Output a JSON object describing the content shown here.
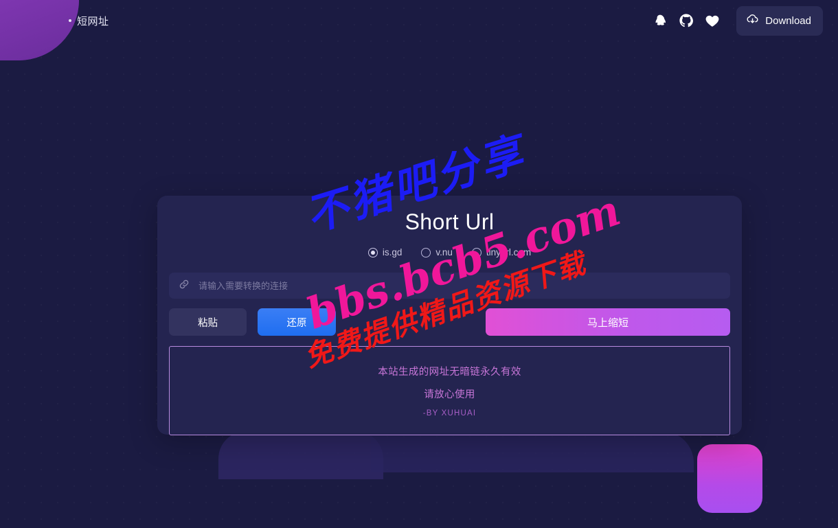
{
  "header": {
    "brand_label": "短网址",
    "icons": [
      {
        "name": "qq-icon",
        "label": "QQ"
      },
      {
        "name": "github-icon",
        "label": "GitHub"
      },
      {
        "name": "heart-icon",
        "label": "Favorite"
      }
    ],
    "download_label": "Download"
  },
  "card": {
    "title": "Short Url",
    "services": [
      {
        "label": "is.gd",
        "checked": true
      },
      {
        "label": "v.nu",
        "checked": false
      },
      {
        "label": "tinyurl.com",
        "checked": false
      }
    ],
    "input": {
      "placeholder": "请输入需要转换的连接",
      "value": ""
    },
    "buttons": {
      "paste": "粘贴",
      "restore": "还原",
      "shorten": "马上缩短"
    },
    "notice": {
      "line1": "本站生成的网址无暗链永久有效",
      "line2": "请放心使用",
      "signature": "-BY XUHUAI"
    }
  },
  "watermarks": {
    "blue": "不猪吧分享",
    "pink": "bbs.bcb5.com",
    "red": "免费提供精品资源下载"
  },
  "colors": {
    "page_bg": "#1b1b42",
    "card_bg": "#242450",
    "accent_pink": "#e150d5",
    "accent_blue": "#2f78f2",
    "notice_border": "#b98ce0",
    "notice_text": "#c876d8",
    "deco_purple": "#6a2d9c"
  }
}
